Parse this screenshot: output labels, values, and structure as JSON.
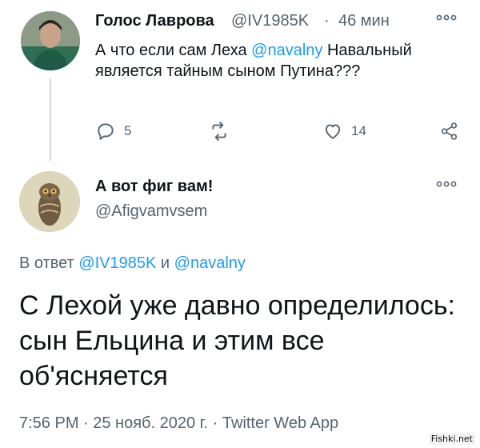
{
  "parent_tweet": {
    "display_name": "Голос Лаврова",
    "handle": "@IV1985K",
    "separator": "·",
    "time": "46 мин",
    "text_before": "А что если сам Леха ",
    "mention": "@navalny",
    "text_after": " Навальный является тайным сыном Путина???",
    "reply_count": "5",
    "retweet_count": "",
    "like_count": "14",
    "more_icon": "ellipsis-icon"
  },
  "main_tweet": {
    "display_name": "А вот фиг вам!",
    "handle": "@Afigvamvsem",
    "replying_prefix": "В ответ ",
    "replying_mention_1": "@IV1985K",
    "replying_and": " и ",
    "replying_mention_2": "@navalny",
    "text": "С Лехой уже давно определилось: сын Ельцина и этим все об'ясняется",
    "meta": "7:56 PM · 25 нояб. 2020 г. · Twitter Web App"
  },
  "watermark": "Fishki.net",
  "colors": {
    "text": "#0f1419",
    "secondary": "#536471",
    "link": "#1d9bf0",
    "thread_line": "#cfd9de"
  }
}
